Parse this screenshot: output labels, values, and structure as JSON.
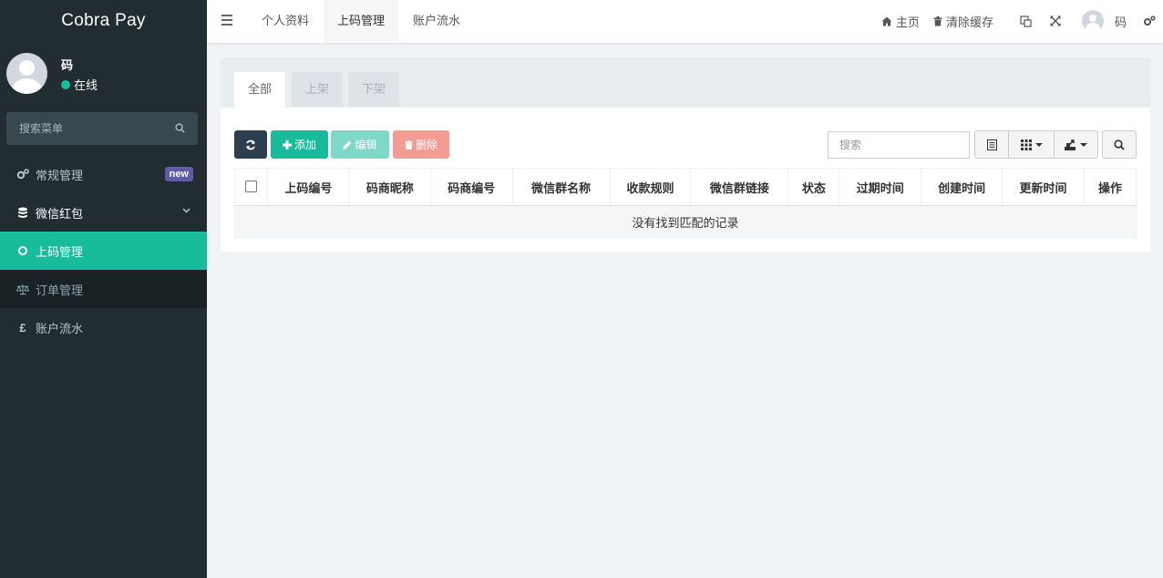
{
  "brand": "Cobra Pay",
  "user": {
    "name": "码",
    "status": "在线"
  },
  "sidebar": {
    "search_placeholder": "搜索菜单",
    "items": [
      {
        "label": "常规管理",
        "icon": "cogs-icon",
        "badge": "new"
      },
      {
        "label": "微信红包",
        "icon": "database-icon"
      },
      {
        "label": "上码管理",
        "icon": "circle-icon",
        "active": true
      },
      {
        "label": "订单管理",
        "icon": "balance-scale-icon"
      },
      {
        "label": "账户流水",
        "icon": "pound-icon"
      }
    ]
  },
  "topbar": {
    "tabs": [
      "个人资料",
      "上码管理",
      "账户流水"
    ],
    "home": "主页",
    "clear_cache": "清除缓存",
    "user_name": "码"
  },
  "content": {
    "tabs": [
      "全部",
      "上架",
      "下架"
    ],
    "buttons": {
      "add": "添加",
      "edit": "编辑",
      "delete": "删除"
    },
    "search_placeholder": "搜索",
    "columns": [
      "上码编号",
      "码商昵称",
      "码商编号",
      "微信群名称",
      "收款规则",
      "微信群链接",
      "状态",
      "过期时间",
      "创建时间",
      "更新时间",
      "操作"
    ],
    "empty_text": "没有找到匹配的记录"
  },
  "colors": {
    "sidebar": "#222d32",
    "accent": "#18bc9c",
    "danger": "#f29c93",
    "badge": "#605ca8"
  }
}
